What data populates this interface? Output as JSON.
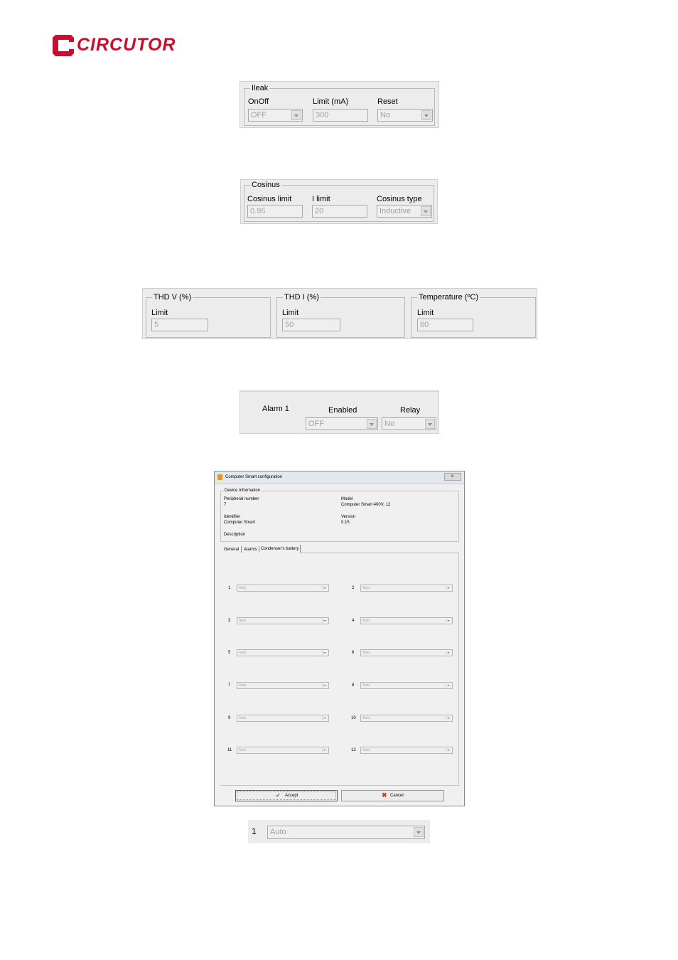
{
  "logo": {
    "text": "CIRCUTOR",
    "color": "#c8102e"
  },
  "ileak": {
    "legend": "Ileak",
    "onoff": {
      "label": "OnOff",
      "value": "OFF"
    },
    "limit": {
      "label": "Limit (mA)",
      "value": "300"
    },
    "reset": {
      "label": "Reset",
      "value": "No"
    }
  },
  "cosinus": {
    "legend": "Cosinus",
    "cos_limit": {
      "label": "Cosinus limit",
      "value": "0.95"
    },
    "i_limit": {
      "label": "I limit",
      "value": "20"
    },
    "cos_type": {
      "label": "Cosinus type",
      "value": "Inductive"
    }
  },
  "thd": {
    "thdv": {
      "legend": "THD V (%)",
      "label": "Limit",
      "value": "5"
    },
    "thdi": {
      "legend": "THD I (%)",
      "label": "Limit",
      "value": "50"
    },
    "temp": {
      "legend": "Temperature (ºC)",
      "label": "Limit",
      "value": "60"
    }
  },
  "alarm": {
    "name": "Alarm 1",
    "enabled": {
      "label": "Enabled",
      "value": "OFF"
    },
    "relay": {
      "label": "Relay",
      "value": "No"
    }
  },
  "dialog": {
    "title": "Computer Smart configuration",
    "close": "x",
    "device_info": {
      "legend": "Device Information",
      "peripheral_label": "Peripheral number",
      "peripheral_value": "7",
      "model_label": "Model",
      "model_value": "Computer Smart 400V, 12",
      "identifier_label": "Identifier",
      "identifier_value": "Computer Smart",
      "version_label": "Version",
      "version_value": "0.15",
      "description_label": "Description"
    },
    "tabs": [
      "General",
      "Alarms",
      "Condenser's battery"
    ],
    "steps": [
      {
        "num": "1",
        "value": "Auto"
      },
      {
        "num": "2",
        "value": "Auto"
      },
      {
        "num": "3",
        "value": "Auto"
      },
      {
        "num": "4",
        "value": "Auto"
      },
      {
        "num": "5",
        "value": "Auto"
      },
      {
        "num": "6",
        "value": "Auto"
      },
      {
        "num": "7",
        "value": "Auto"
      },
      {
        "num": "8",
        "value": "Auto"
      },
      {
        "num": "9",
        "value": "Auto"
      },
      {
        "num": "10",
        "value": "Auto"
      },
      {
        "num": "11",
        "value": "Auto"
      },
      {
        "num": "12",
        "value": "Auto"
      }
    ],
    "accept": "Accept",
    "cancel": "Cancel"
  },
  "step_zoom": {
    "num": "1",
    "value": "Auto"
  }
}
